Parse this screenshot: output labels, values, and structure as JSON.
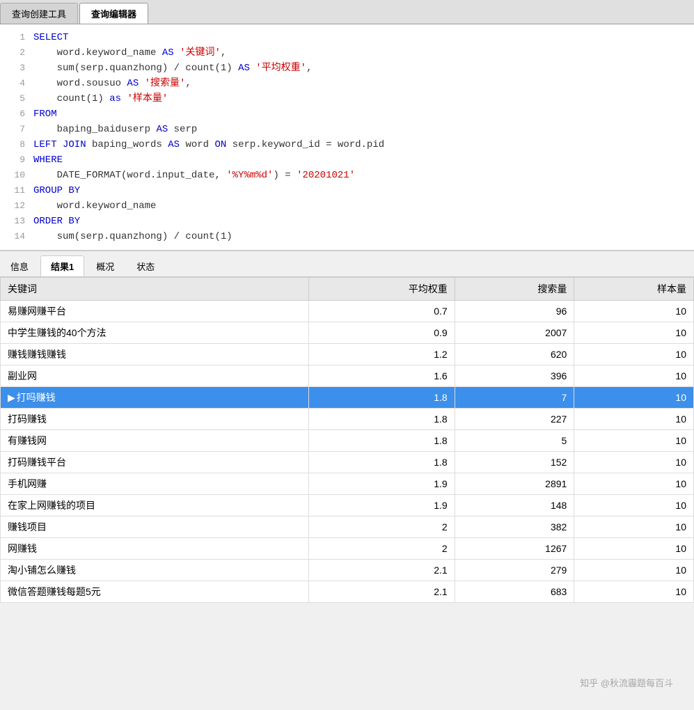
{
  "tabs": {
    "top": [
      {
        "label": "查询创建工具",
        "active": false
      },
      {
        "label": "查询编辑器",
        "active": true
      }
    ],
    "bottom": [
      {
        "label": "信息",
        "active": false
      },
      {
        "label": "结果1",
        "active": true
      },
      {
        "label": "概况",
        "active": false
      },
      {
        "label": "状态",
        "active": false
      }
    ]
  },
  "code": {
    "lines": [
      {
        "num": "1",
        "html": "<span class='kw-blue'>SELECT</span>"
      },
      {
        "num": "2",
        "html": "    word.keyword_name <span class='kw-blue'>AS</span> <span class='str-red'>'关键词'</span>,"
      },
      {
        "num": "3",
        "html": "    sum(serp.quanzhong) / count(1) <span class='kw-blue'>AS</span> <span class='str-red'>'平均权重'</span>,"
      },
      {
        "num": "4",
        "html": "    word.sousuo <span class='kw-blue'>AS</span> <span class='str-red'>'搜索量'</span>,"
      },
      {
        "num": "5",
        "html": "    count(1) <span class='kw-blue'>as</span> <span class='str-red'>'样本量'</span>"
      },
      {
        "num": "6",
        "html": "<span class='kw-blue'>FROM</span>"
      },
      {
        "num": "7",
        "html": "    baping_baiduserp <span class='kw-blue'>AS</span> serp"
      },
      {
        "num": "8",
        "html": "<span class='kw-blue'>LEFT JOIN</span> baping_words <span class='kw-blue'>AS</span> word <span class='kw-blue'>ON</span> serp.keyword_id = word.pid"
      },
      {
        "num": "9",
        "html": "<span class='kw-blue'>WHERE</span>"
      },
      {
        "num": "10",
        "html": "    DATE_FORMAT(word.input_date, <span class='str-red'>'%Y%m%d'</span>) = <span class='str-red'>'20201021'</span>"
      },
      {
        "num": "11",
        "html": "<span class='kw-blue'>GROUP BY</span>"
      },
      {
        "num": "12",
        "html": "    word.keyword_name"
      },
      {
        "num": "13",
        "html": "<span class='kw-blue'>ORDER BY</span>"
      },
      {
        "num": "14",
        "html": "    sum(serp.quanzhong) / count(1)"
      }
    ]
  },
  "table": {
    "headers": [
      "关键词",
      "平均权重",
      "搜索量",
      "样本量"
    ],
    "rows": [
      {
        "keyword": "易赚网赚平台",
        "avg_weight": "0.7",
        "search_vol": "96",
        "sample": "10",
        "selected": false,
        "indicator": false
      },
      {
        "keyword": "中学生赚钱的40个方法",
        "avg_weight": "0.9",
        "search_vol": "2007",
        "sample": "10",
        "selected": false,
        "indicator": false
      },
      {
        "keyword": "赚钱赚钱赚钱",
        "avg_weight": "1.2",
        "search_vol": "620",
        "sample": "10",
        "selected": false,
        "indicator": false
      },
      {
        "keyword": "副业网",
        "avg_weight": "1.6",
        "search_vol": "396",
        "sample": "10",
        "selected": false,
        "indicator": false
      },
      {
        "keyword": "打吗赚钱",
        "avg_weight": "1.8",
        "search_vol": "7",
        "sample": "10",
        "selected": true,
        "indicator": true
      },
      {
        "keyword": "打码赚钱",
        "avg_weight": "1.8",
        "search_vol": "227",
        "sample": "10",
        "selected": false,
        "indicator": false
      },
      {
        "keyword": "有赚钱网",
        "avg_weight": "1.8",
        "search_vol": "5",
        "sample": "10",
        "selected": false,
        "indicator": false
      },
      {
        "keyword": "打码赚钱平台",
        "avg_weight": "1.8",
        "search_vol": "152",
        "sample": "10",
        "selected": false,
        "indicator": false
      },
      {
        "keyword": "手机网赚",
        "avg_weight": "1.9",
        "search_vol": "2891",
        "sample": "10",
        "selected": false,
        "indicator": false
      },
      {
        "keyword": "在家上网赚钱的项目",
        "avg_weight": "1.9",
        "search_vol": "148",
        "sample": "10",
        "selected": false,
        "indicator": false
      },
      {
        "keyword": "赚钱项目",
        "avg_weight": "2",
        "search_vol": "382",
        "sample": "10",
        "selected": false,
        "indicator": false
      },
      {
        "keyword": "网赚钱",
        "avg_weight": "2",
        "search_vol": "1267",
        "sample": "10",
        "selected": false,
        "indicator": false
      },
      {
        "keyword": "淘小铺怎么赚钱",
        "avg_weight": "2.1",
        "search_vol": "279",
        "sample": "10",
        "selected": false,
        "indicator": false
      },
      {
        "keyword": "微信答题赚钱每题5元",
        "avg_weight": "2.1",
        "search_vol": "683",
        "sample": "10",
        "selected": false,
        "indicator": false
      }
    ]
  },
  "watermark": "知乎 @秋流霾题每百斗"
}
